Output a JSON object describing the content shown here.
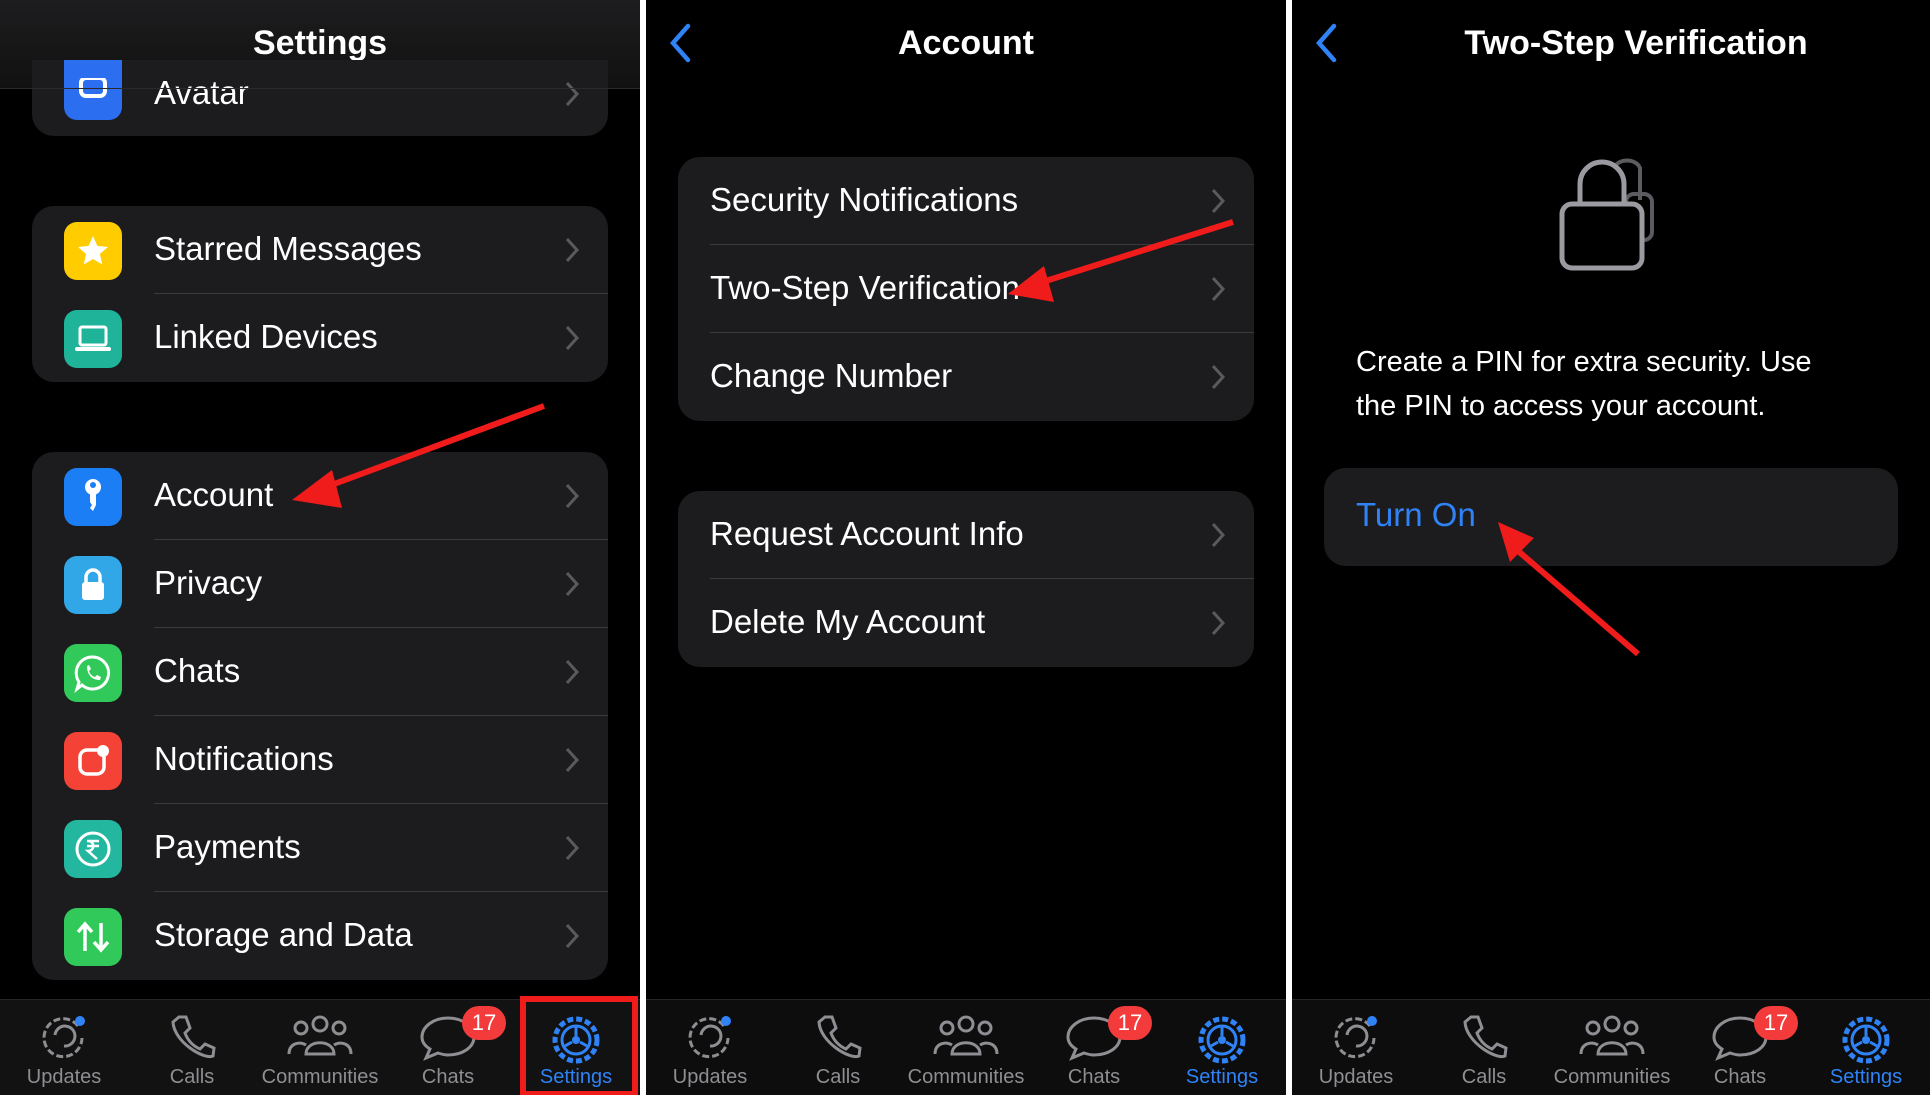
{
  "panels": {
    "settings": {
      "title": "Settings",
      "avatar_label": "Avatar",
      "group2": [
        {
          "label": "Starred Messages",
          "icon": "star-icon",
          "color": "#ffcc00"
        },
        {
          "label": "Linked Devices",
          "icon": "laptop-icon",
          "color": "#1fb39a"
        }
      ],
      "group3": [
        {
          "label": "Account",
          "icon": "key-icon",
          "color": "#1c7ef5"
        },
        {
          "label": "Privacy",
          "icon": "lock-icon",
          "color": "#31a7e8"
        },
        {
          "label": "Chats",
          "icon": "whatsapp-icon",
          "color": "#30c95a"
        },
        {
          "label": "Notifications",
          "icon": "notification-icon",
          "color": "#f44336"
        },
        {
          "label": "Payments",
          "icon": "rupee-icon",
          "color": "#24b7a0"
        },
        {
          "label": "Storage and Data",
          "icon": "arrows-updown-icon",
          "color": "#30c95a"
        }
      ]
    },
    "account": {
      "title": "Account",
      "group1": [
        "Security Notifications",
        "Two-Step Verification",
        "Change Number"
      ],
      "group2": [
        "Request Account Info",
        "Delete My Account"
      ]
    },
    "two_step": {
      "title": "Two-Step Verification",
      "description_line1": "Create a PIN for extra security. Use",
      "description_line2": "the PIN to access your account.",
      "turn_on": "Turn On"
    }
  },
  "tabbar": {
    "tabs": [
      "Updates",
      "Calls",
      "Communities",
      "Chats",
      "Settings"
    ],
    "chats_badge": "17",
    "active": "Settings"
  },
  "colors": {
    "accent": "#2f83f7",
    "annotation": "#f01b1b",
    "cell_bg": "#1c1c1e"
  }
}
